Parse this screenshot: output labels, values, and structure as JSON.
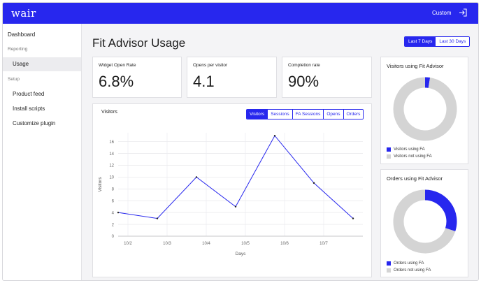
{
  "app": {
    "logo": "wair"
  },
  "header": {
    "custom_label": "Custom"
  },
  "colors": {
    "accent": "#2727ee",
    "muted": "#d4d4d4"
  },
  "sidebar": {
    "items": [
      {
        "label": "Dashboard",
        "type": "item"
      },
      {
        "label": "Reporting",
        "type": "section"
      },
      {
        "label": "Usage",
        "type": "sub",
        "active": true
      },
      {
        "label": "Setup",
        "type": "section"
      },
      {
        "label": "Product feed",
        "type": "sub"
      },
      {
        "label": "Install scripts",
        "type": "sub"
      },
      {
        "label": "Customize plugin",
        "type": "sub"
      }
    ]
  },
  "page": {
    "title": "Fit Advisor Usage",
    "range": [
      {
        "label": "Last 7 Days",
        "active": true
      },
      {
        "label": "Last 30 Days",
        "active": false
      }
    ]
  },
  "stats": [
    {
      "label": "Widget Open Rate",
      "value": "6.8%"
    },
    {
      "label": "Opens per visitor",
      "value": "4.1"
    },
    {
      "label": "Completion rate",
      "value": "90%"
    }
  ],
  "chart_card": {
    "title": "Visitors",
    "tabs": [
      {
        "label": "Visitors",
        "active": true
      },
      {
        "label": "Sessions",
        "active": false
      },
      {
        "label": "FA Sessions",
        "active": false
      },
      {
        "label": "Opens",
        "active": false
      },
      {
        "label": "Orders",
        "active": false
      }
    ]
  },
  "chart_data": [
    {
      "type": "line",
      "title": "Visitors",
      "xlabel": "Days",
      "ylabel": "Visitors",
      "x_ticks": [
        "10/2",
        "10/3",
        "10/4",
        "10/5",
        "10/6",
        "10/7"
      ],
      "x_range": [
        "10/1 18:00",
        "10/8 00:00"
      ],
      "ylim": [
        0,
        17.5
      ],
      "y_ticks": [
        0,
        2,
        4,
        6,
        8,
        10,
        12,
        14,
        16
      ],
      "grid": true,
      "series": [
        {
          "points": [
            {
              "x": "10/1 18:00",
              "y": 4
            },
            {
              "x": "10/2 18:00",
              "y": 3
            },
            {
              "x": "10/3 18:00",
              "y": 10
            },
            {
              "x": "10/4 18:00",
              "y": 5
            },
            {
              "x": "10/5 18:00",
              "y": 17
            },
            {
              "x": "10/6 18:00",
              "y": 9
            },
            {
              "x": "10/7 18:00",
              "y": 3
            }
          ]
        }
      ]
    },
    {
      "type": "pie",
      "title": "Visitors using Fit Advisor",
      "donut": true,
      "slices": [
        {
          "label": "Visitors using FA",
          "value": 2.5
        },
        {
          "label": "Visitors not using FA",
          "value": 97.5
        }
      ]
    },
    {
      "type": "pie",
      "title": "Orders using Fit Advisor",
      "donut": true,
      "slices": [
        {
          "label": "Orders using FA",
          "value": 30
        },
        {
          "label": "Orders not using FA",
          "value": 70
        }
      ]
    }
  ]
}
